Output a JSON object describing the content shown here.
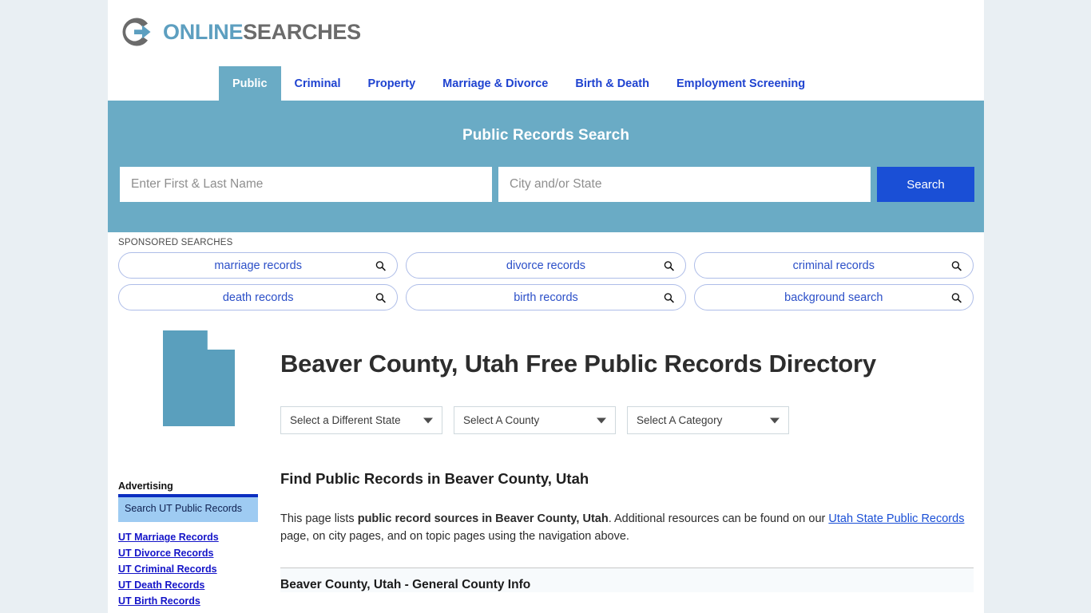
{
  "brand": {
    "logo_icon": "circle-arrow-logo-icon",
    "name_part1": "ONLINE",
    "name_part2": "SEARCHES",
    "accent_color": "#5d9fc0",
    "secondary_color": "#6b6b6b"
  },
  "nav": {
    "items": [
      {
        "label": "Public",
        "active": true
      },
      {
        "label": "Criminal",
        "active": false
      },
      {
        "label": "Property",
        "active": false
      },
      {
        "label": "Marriage & Divorce",
        "active": false
      },
      {
        "label": "Birth & Death",
        "active": false
      },
      {
        "label": "Employment Screening",
        "active": false
      }
    ],
    "active_bg": "#6aabc5",
    "link_color": "#1f43d0"
  },
  "search": {
    "band_color": "#6aabc5",
    "title": "Public Records Search",
    "name_value": "",
    "name_placeholder": "Enter First & Last Name",
    "city_value": "",
    "city_placeholder": "City and/or State",
    "button_label": "Search",
    "button_color": "#1a4fd6"
  },
  "sponsored": {
    "label": "SPONSORED SEARCHES",
    "icon": "search-icon",
    "pills": [
      {
        "label": "marriage records"
      },
      {
        "label": "divorce records"
      },
      {
        "label": "criminal records"
      },
      {
        "label": "death records"
      },
      {
        "label": "birth records"
      },
      {
        "label": "background search"
      }
    ]
  },
  "sidebar": {
    "state_shape_name": "utah-state-map-icon",
    "state_shape_color": "#5a9fbd",
    "advertising_label": "Advertising",
    "ad_box_text": "Search UT Public Records",
    "ad_box_bg": "#9ecbf2",
    "links": [
      {
        "label": "UT Marriage Records"
      },
      {
        "label": "UT Divorce Records"
      },
      {
        "label": "UT Criminal Records"
      },
      {
        "label": "UT Death Records"
      },
      {
        "label": "UT Birth Records"
      }
    ]
  },
  "main": {
    "page_title": "Beaver County, Utah Free Public Records Directory",
    "selects": [
      {
        "name": "state",
        "value": "Select a Different State"
      },
      {
        "name": "county",
        "value": "Select A County"
      },
      {
        "name": "category",
        "value": "Select A Category"
      }
    ],
    "section_heading": "Find Public Records in Beaver County, Utah",
    "intro": {
      "part1": "This page lists ",
      "bold": "public record sources in Beaver County, Utah",
      "part2": ". Additional resources can be found on our ",
      "link": "Utah State Public Records",
      "part3": " page, on city pages, and on topic pages using the navigation above."
    },
    "info_panel_title": "Beaver County, Utah - General County Info"
  }
}
